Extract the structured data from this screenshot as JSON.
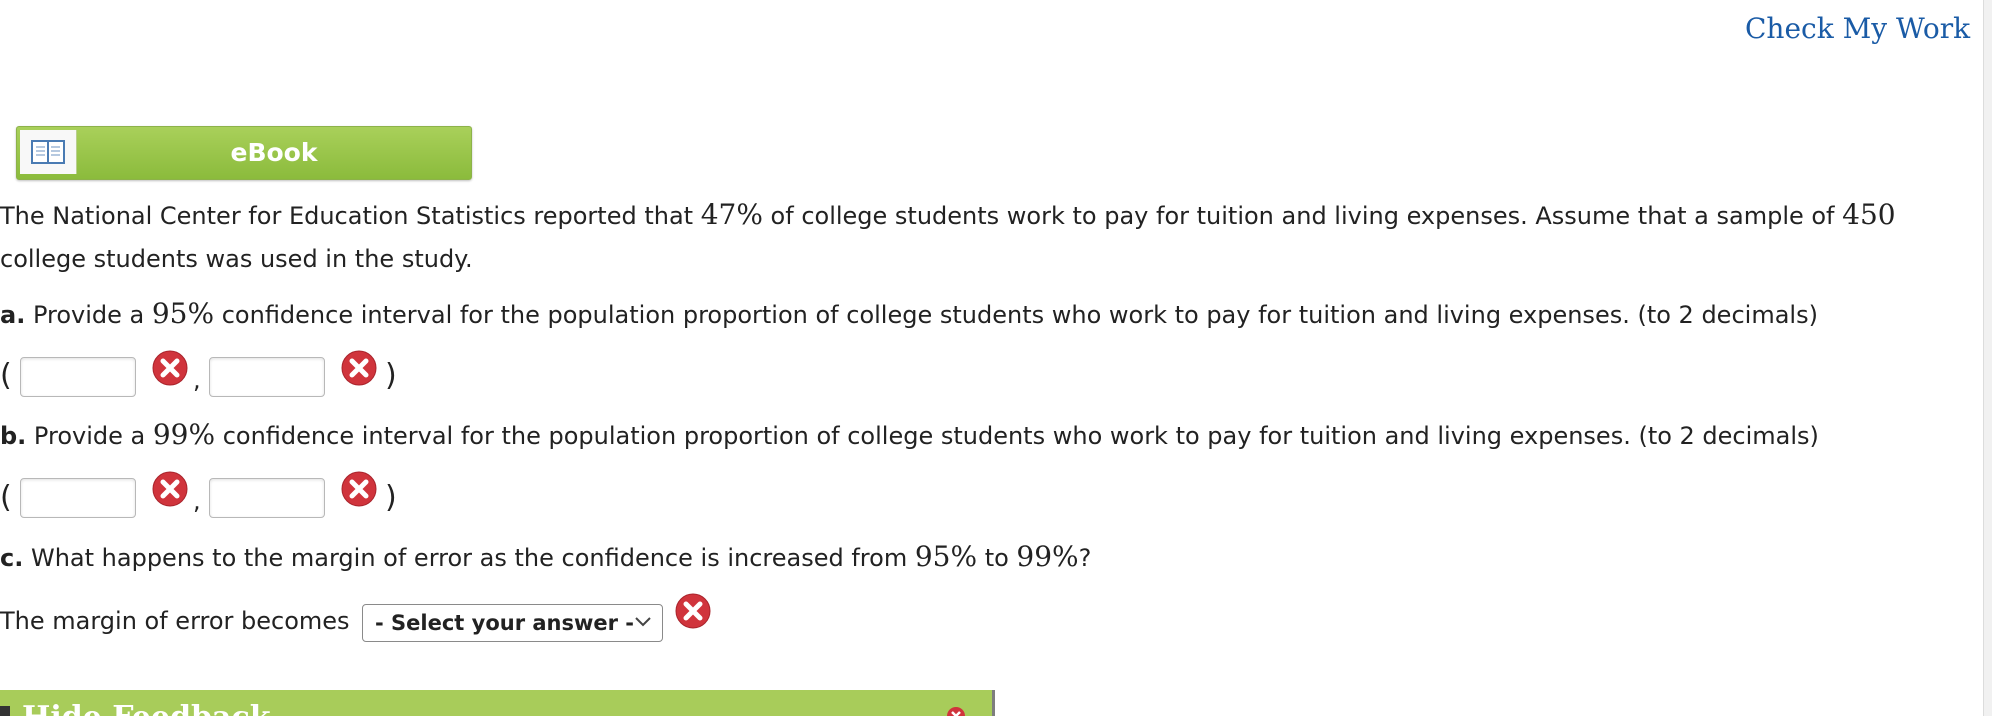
{
  "header": {
    "check_my_work": "Check My Work"
  },
  "ebook": {
    "label": "eBook",
    "icon": "book-icon"
  },
  "problem": {
    "intro_1": "The National Center for Education Statistics reported that ",
    "pct_work": "47%",
    "intro_2": " of college students work to pay for tuition and living expenses. Assume that a sample of ",
    "sample_size": "450",
    "intro_line2": "college students was used in the study."
  },
  "part_a": {
    "letter": "a.",
    "text_1": " Provide a ",
    "confidence": "95%",
    "text_2": " confidence interval for the population proportion of college students who work to pay for tuition and living expenses. (to 2 decimals)",
    "open_paren": "(",
    "comma": ",",
    "close_paren": ")",
    "lower_value": "",
    "upper_value": ""
  },
  "part_b": {
    "letter": "b.",
    "text_1": " Provide a ",
    "confidence": "99%",
    "text_2": " confidence interval for the population proportion of college students who work to pay for tuition and living expenses. (to 2 decimals)",
    "open_paren": "(",
    "comma": ",",
    "close_paren": ")",
    "lower_value": "",
    "upper_value": ""
  },
  "part_c": {
    "letter": "c.",
    "text_1": " What happens to the margin of error as the confidence is increased from ",
    "from": "95%",
    "text_2": " to ",
    "to": "99%",
    "text_3": "?",
    "answer_prefix": "The margin of error becomes",
    "select_value": "- Select your answer -"
  },
  "feedback": {
    "label": "Hide Feedback"
  },
  "status": {
    "incorrect_icon": "incorrect-x-icon",
    "incorrect_color": "#d0343c"
  }
}
